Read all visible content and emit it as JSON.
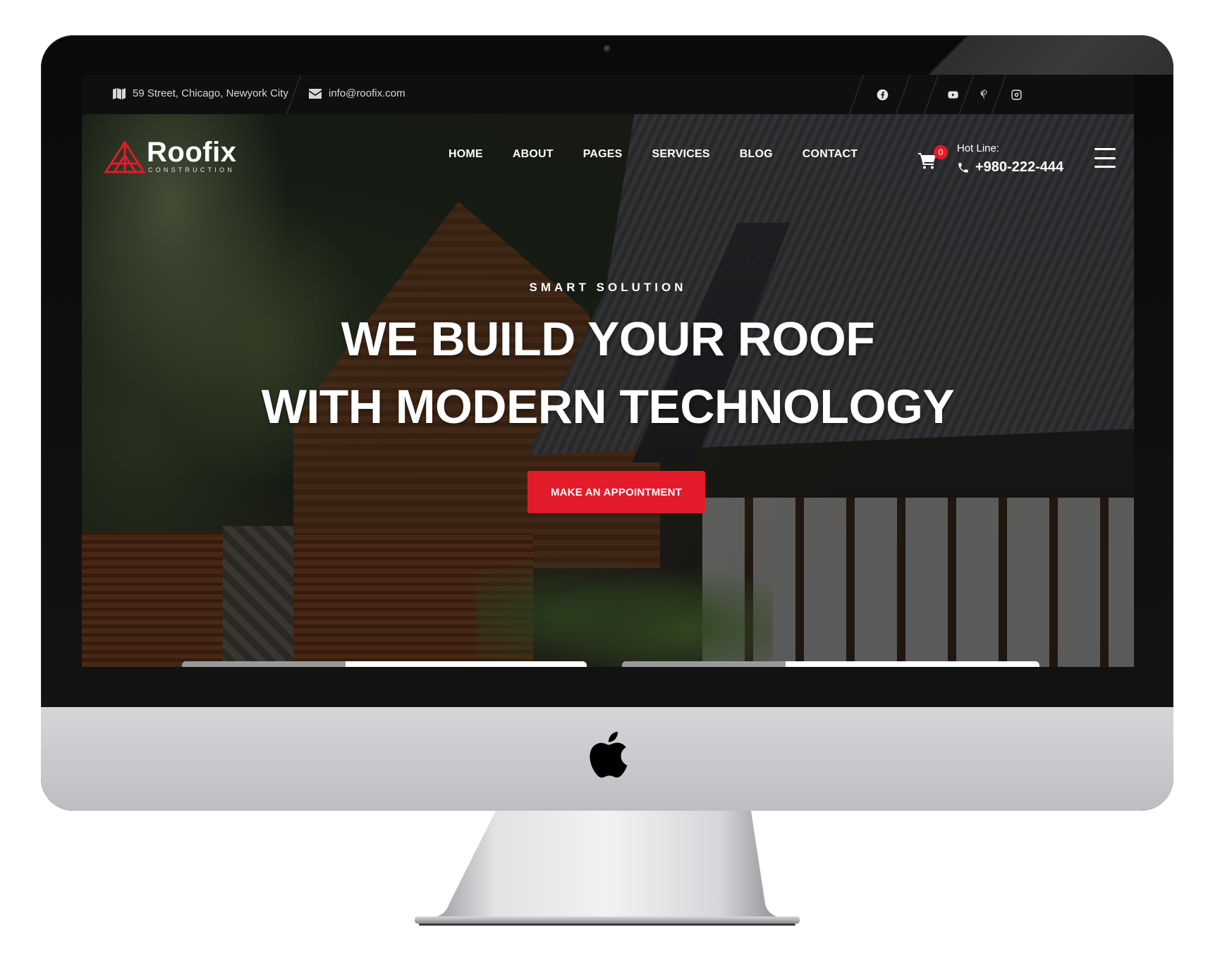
{
  "topbar": {
    "address": "59 Street, Chicago, Newyork City",
    "email": "info@roofix.com",
    "social": [
      "facebook-icon",
      "youtube-icon",
      "pinterest-icon",
      "instagram-icon"
    ]
  },
  "brand": {
    "name": "Roofix",
    "tagline": "CONSTRUCTION",
    "accent": "#e31b2b"
  },
  "nav": {
    "items": [
      {
        "label": "HOME"
      },
      {
        "label": "ABOUT"
      },
      {
        "label": "PAGES"
      },
      {
        "label": "SERVICES"
      },
      {
        "label": "BLOG"
      },
      {
        "label": "CONTACT"
      }
    ]
  },
  "header": {
    "cart_count": "0",
    "hotline_label": "Hot Line:",
    "hotline_number": "+980-222-444"
  },
  "hero": {
    "eyebrow": "SMART SOLUTION",
    "headline_line1": "WE BUILD YOUR ROOF",
    "headline_line2": "WITH MODERN TECHNOLOGY",
    "cta_label": "MAKE AN APPOINTMENT"
  }
}
